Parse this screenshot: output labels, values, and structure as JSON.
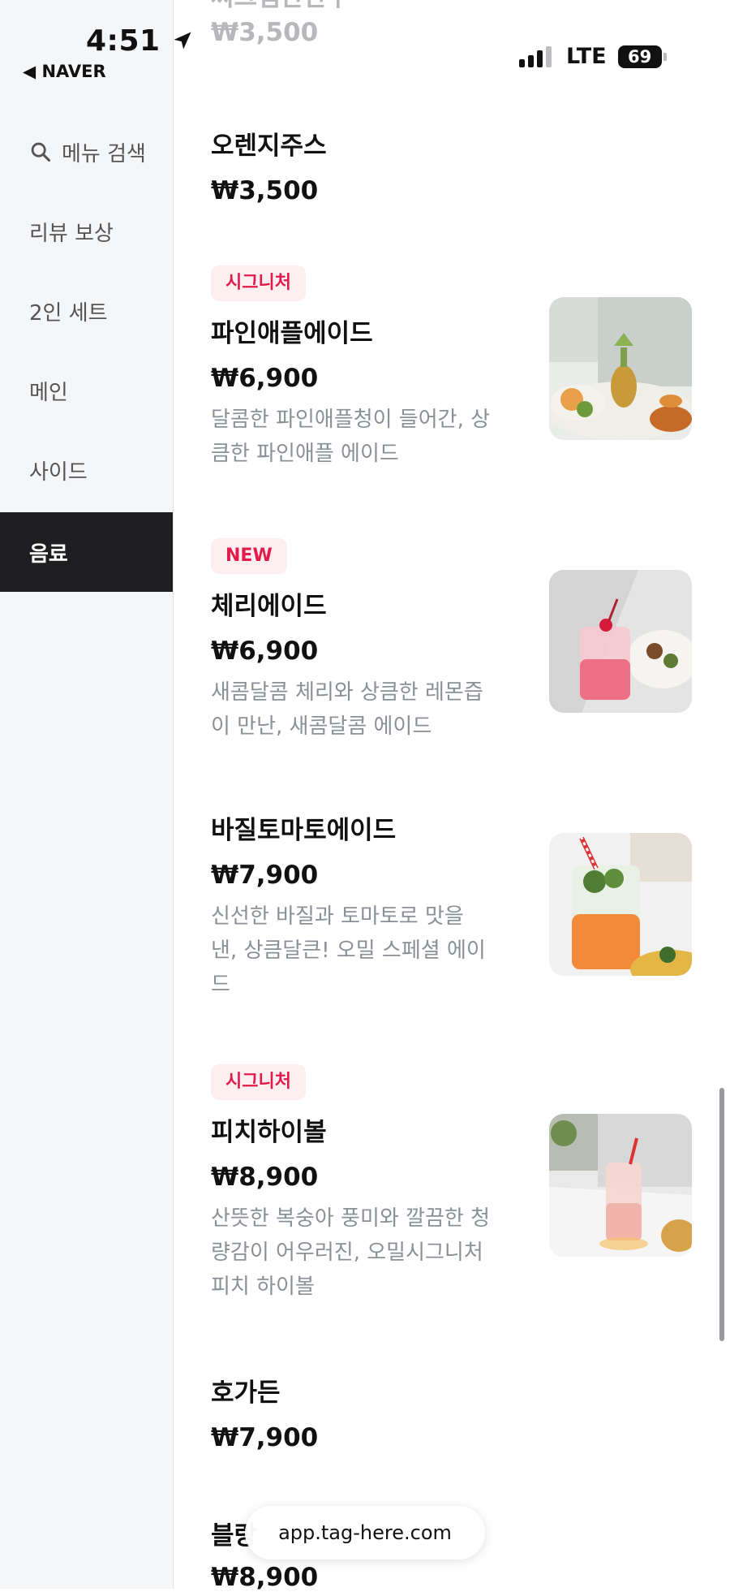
{
  "status": {
    "time": "4:51",
    "back_app": "◀ NAVER",
    "network": "LTE",
    "battery": "69"
  },
  "sidebar": {
    "search_label": "메뉴 검색",
    "items": [
      {
        "label": "리뷰 보상"
      },
      {
        "label": "2인 세트"
      },
      {
        "label": "메인"
      },
      {
        "label": "사이드"
      },
      {
        "label": "음료",
        "active": true
      }
    ]
  },
  "menu": {
    "top_partial": {
      "name": "씨그램탄산수",
      "price": "₩3,500"
    },
    "items": [
      {
        "name": "오렌지주스",
        "price": "₩3,500"
      },
      {
        "badge": "시그니처",
        "name": "파인애플에이드",
        "price": "₩6,900",
        "desc_lines": [
          "달콤한 파인애플청이 들어간, 상",
          "큼한 파인애플 에이드"
        ]
      },
      {
        "badge": "NEW",
        "name": "체리에이드",
        "price": "₩6,900",
        "desc_lines": [
          "새콤달콤 체리와 상큼한 레몬즙",
          "이 만난, 새콤달콤 에이드"
        ]
      },
      {
        "name": "바질토마토에이드",
        "price": "₩7,900",
        "desc_lines": [
          "신선한 바질과 토마토로 맛을",
          "낸, 상큼달큰! 오밀 스페셜 에이",
          "드"
        ]
      },
      {
        "badge": "시그니처",
        "name": "피치하이볼",
        "price": "₩8,900",
        "desc_lines": [
          "산뜻한 복숭아 풍미와 깔끔한 청",
          "량감이 어우러진, 오밀시그니처",
          "피치 하이볼"
        ]
      },
      {
        "name": "호가든",
        "price": "₩7,900"
      },
      {
        "name": "블랑",
        "price": "₩8,900"
      }
    ]
  },
  "urlbar": {
    "text": "app.tag-here.com"
  },
  "colors": {
    "accent": "#e31b4a",
    "sidebar_active": "#1e1e20"
  }
}
